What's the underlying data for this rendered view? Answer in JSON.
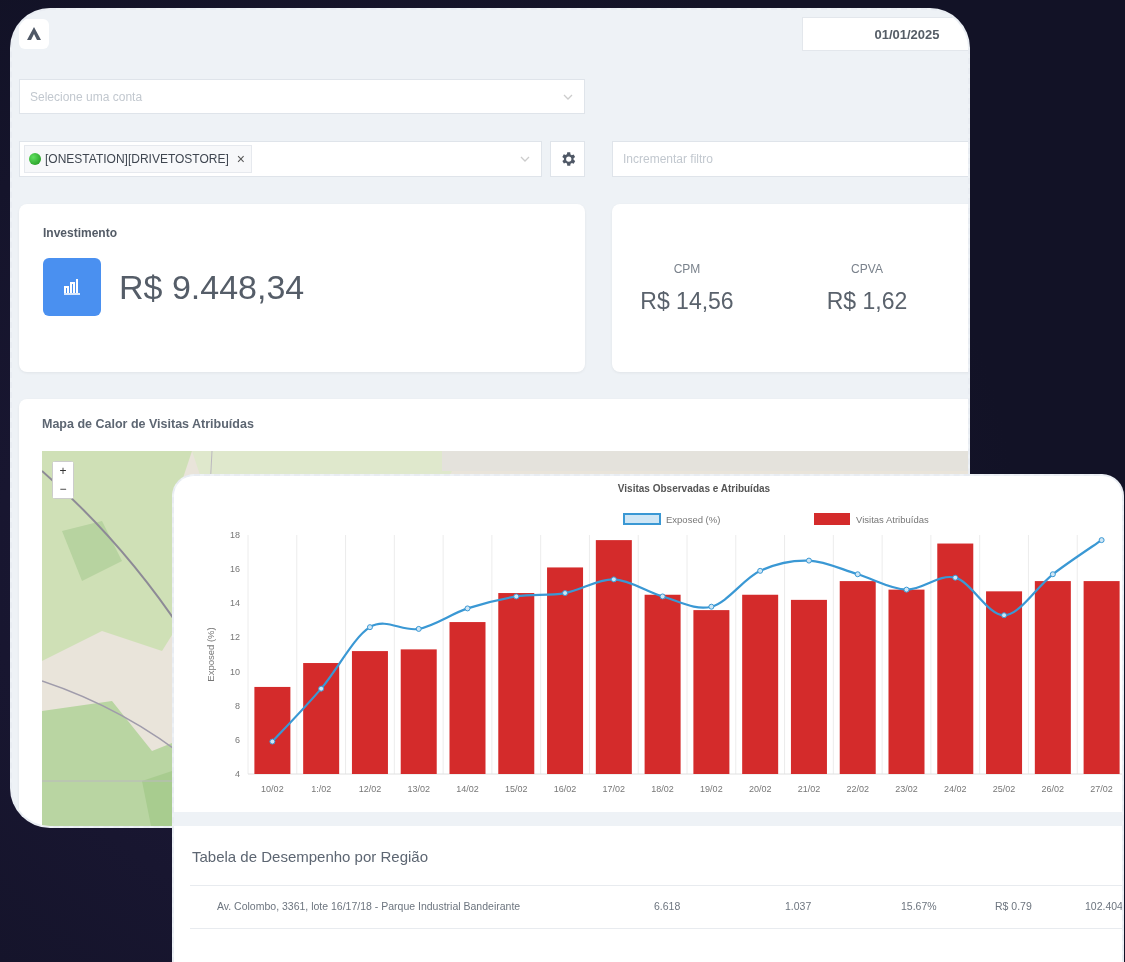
{
  "back_window": {
    "date_field": {
      "value": "01/01/2025"
    },
    "account_select": {
      "placeholder": "Selecione uma conta"
    },
    "campaign_select": {
      "tags": [
        {
          "label": "[ONESTATION][DRIVETOSTORE]",
          "remove": "×"
        }
      ]
    },
    "filter_field": {
      "placeholder": "Incrementar filtro"
    },
    "investment_card": {
      "label": "Investimento",
      "value": "R$ 9.448,34"
    },
    "metrics": [
      {
        "label": "CPM",
        "value": "R$ 14,56"
      },
      {
        "label": "CPVA",
        "value": "R$ 1,62"
      }
    ],
    "map_card": {
      "title": "Mapa de Calor de Visitas Atribuídas",
      "zoom_in": "+",
      "zoom_out": "−"
    }
  },
  "front_window": {
    "chart_data": {
      "type": "bar",
      "title": "Visitas Observadas e Atribuídas",
      "ylabel": "Exposed (%)",
      "categories": [
        "10/02",
        "1:/02",
        "12/02",
        "13/02",
        "14/02",
        "15/02",
        "16/02",
        "17/02",
        "18/02",
        "19/02",
        "20/02",
        "21/02",
        "22/02",
        "23/02",
        "24/02",
        "25/02",
        "26/02",
        "27/02"
      ],
      "legend": "top",
      "ylim": [
        4,
        18
      ],
      "yticks": [
        4,
        6,
        8,
        10,
        12,
        14,
        16,
        18
      ],
      "series": [
        {
          "name": "Exposed (%)",
          "type": "line",
          "marker": "o",
          "color": "#3a98d4",
          "values": [
            5.9,
            9.0,
            12.6,
            12.5,
            13.7,
            14.4,
            14.6,
            15.4,
            14.4,
            13.8,
            15.9,
            16.5,
            15.7,
            14.8,
            15.5,
            13.3,
            15.7,
            17.7
          ]
        },
        {
          "name": "Visitas Atribuídas",
          "type": "bar",
          "color": "#d42b2b",
          "values": [
            9.1,
            10.5,
            11.2,
            11.3,
            12.9,
            14.6,
            16.1,
            17.7,
            14.5,
            13.6,
            14.5,
            14.2,
            15.3,
            14.8,
            17.5,
            14.7,
            15.3,
            15.3
          ]
        }
      ]
    },
    "table": {
      "title": "Tabela de Desempenho por Região",
      "rows": [
        {
          "column_1": "Av. Colombo, 3361, lote 16/17/18 - Parque Industrial Bandeirante",
          "column_2": "6.618",
          "column_3": "1.037",
          "column_4": "15.67%",
          "column_5": "R$ 0.79",
          "column_6": "102.404"
        }
      ]
    }
  }
}
